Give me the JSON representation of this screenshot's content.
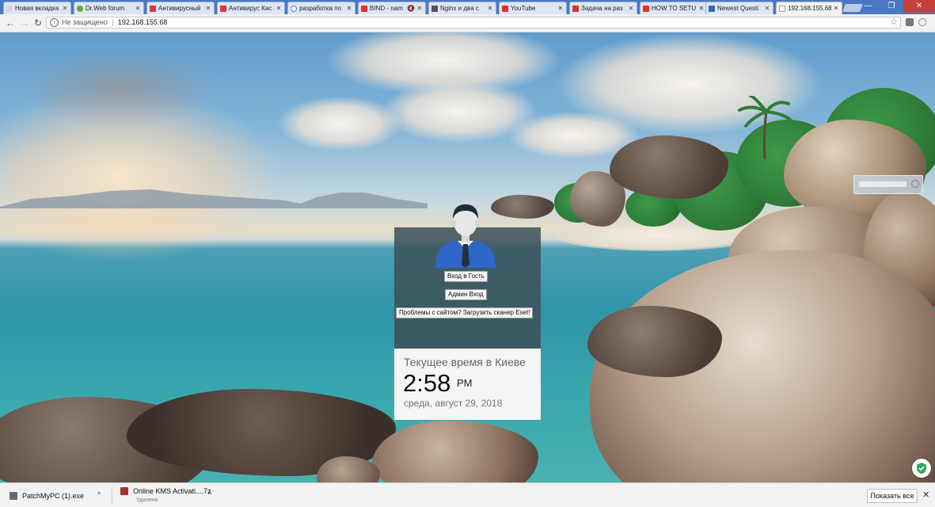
{
  "tabs": [
    {
      "title": "Новая вкладка",
      "icon": "blank-page-icon",
      "color": "#cfd6e2"
    },
    {
      "title": "Dr.Web forum",
      "icon": "drweb-spider-icon",
      "color": "#6aa83a"
    },
    {
      "title": "Антивирусный",
      "icon": "kaspersky-icon",
      "color": "#d93a3a"
    },
    {
      "title": "Антивирус Кас",
      "icon": "kaspersky-icon",
      "color": "#d93a3a"
    },
    {
      "title": "разработка по",
      "icon": "google-icon",
      "color": "#4285f4"
    },
    {
      "title": "BIND - nam",
      "icon": "youtube-icon",
      "color": "#e52d27",
      "muted": true
    },
    {
      "title": "Nginx и два с",
      "icon": "bookmark-icon",
      "color": "#555555"
    },
    {
      "title": "YouTube",
      "icon": "youtube-icon",
      "color": "#e52d27"
    },
    {
      "title": "Задача на раз",
      "icon": "stackoverflow-icon",
      "color": "#d3392f"
    },
    {
      "title": "HOW TO SETU",
      "icon": "youtube-icon",
      "color": "#e52d27"
    },
    {
      "title": "Newest Questi",
      "icon": "stackexchange-icon",
      "color": "#3c6aa8"
    },
    {
      "title": "192.168.155.68",
      "icon": "page-icon",
      "color": "#999999",
      "active": true
    }
  ],
  "addressbar": {
    "security_label": "Не защищено",
    "url": "192.168.155.68"
  },
  "login": {
    "guest_button": "Вход в Гость",
    "admin_button": "Админ Вход",
    "scanner_button": "Проблемы с сайтом? Загрузить сканер Eset!"
  },
  "clock": {
    "title": "Текущее время в Киеве",
    "time": "2:58",
    "ampm": "PM",
    "date": "среда, август 29, 2018"
  },
  "downloads": {
    "items": [
      {
        "name": "PatchMyPC (1).exe",
        "status": "",
        "icon": "exe-file-icon"
      },
      {
        "name": "Online KMS Activati....7z",
        "status": "Удалено",
        "icon": "archive-file-icon"
      }
    ],
    "show_all": "Показать все"
  },
  "colors": {
    "tabstrip": "#4a78c2",
    "panel": "#3c5058",
    "accent_shirt": "#2f66c9"
  }
}
